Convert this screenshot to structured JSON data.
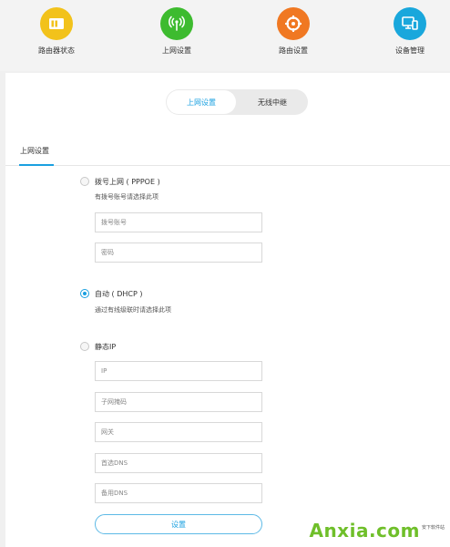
{
  "nav": {
    "items": [
      {
        "label": "路由器状态",
        "icon": "status-card-icon",
        "color": "#f2c21b"
      },
      {
        "label": "上网设置",
        "icon": "antenna-icon",
        "color": "#3dbb2f"
      },
      {
        "label": "路由设置",
        "icon": "gear-icon",
        "color": "#f07822"
      },
      {
        "label": "设备管理",
        "icon": "devices-icon",
        "color": "#19a7dc"
      }
    ]
  },
  "tabs": {
    "items": [
      "上网设置",
      "无线中继"
    ],
    "active": "上网设置"
  },
  "section": {
    "title": "上网设置"
  },
  "options": {
    "pppoe": {
      "label": "拨号上网 ( PPPOE )",
      "hint": "有拨号账号请选择此项",
      "checked": false,
      "fields": [
        {
          "placeholder": "拨号账号"
        },
        {
          "placeholder": "密码"
        }
      ]
    },
    "dhcp": {
      "label": "自动 ( DHCP )",
      "hint": "通过有线级联时请选择此项",
      "checked": true
    },
    "static": {
      "label": "静态IP",
      "checked": false,
      "fields": [
        {
          "placeholder": "IP"
        },
        {
          "placeholder": "子网掩码"
        },
        {
          "placeholder": "网关"
        },
        {
          "placeholder": "首选DNS"
        },
        {
          "placeholder": "备用DNS"
        }
      ]
    }
  },
  "submit": {
    "label": "设置"
  },
  "watermark": {
    "logo": "Anxia.com",
    "sub": "安下软件站"
  },
  "colors": {
    "accent": "#1aa0e0",
    "watermark": "#6fbf2a"
  }
}
